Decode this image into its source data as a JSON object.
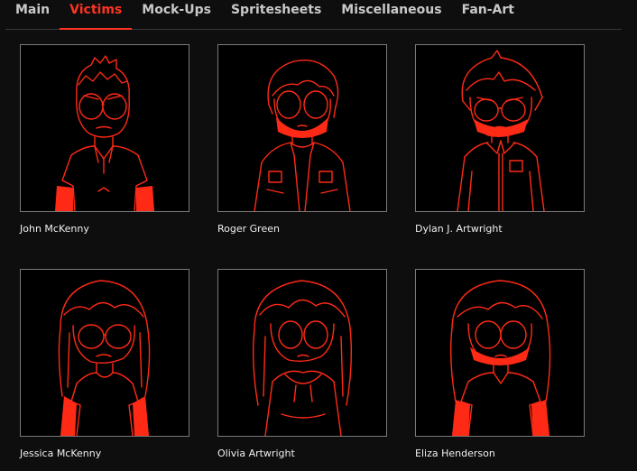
{
  "tabs": [
    {
      "label": "Main",
      "active": false
    },
    {
      "label": "Victims",
      "active": true
    },
    {
      "label": "Mock-Ups",
      "active": false
    },
    {
      "label": "Spritesheets",
      "active": false
    },
    {
      "label": "Miscellaneous",
      "active": false
    },
    {
      "label": "Fan-Art",
      "active": false
    }
  ],
  "gallery": {
    "items": [
      {
        "name": "John McKenny"
      },
      {
        "name": "Roger Green"
      },
      {
        "name": "Dylan J. Artwright"
      },
      {
        "name": "Jessica McKenny"
      },
      {
        "name": "Olivia Artwright"
      },
      {
        "name": "Eliza Henderson"
      }
    ]
  },
  "colors": {
    "accent": "#ff3322",
    "art_stroke": "#ff2a16",
    "background": "#0e0e0e",
    "frame_border": "#7a7a7a"
  }
}
